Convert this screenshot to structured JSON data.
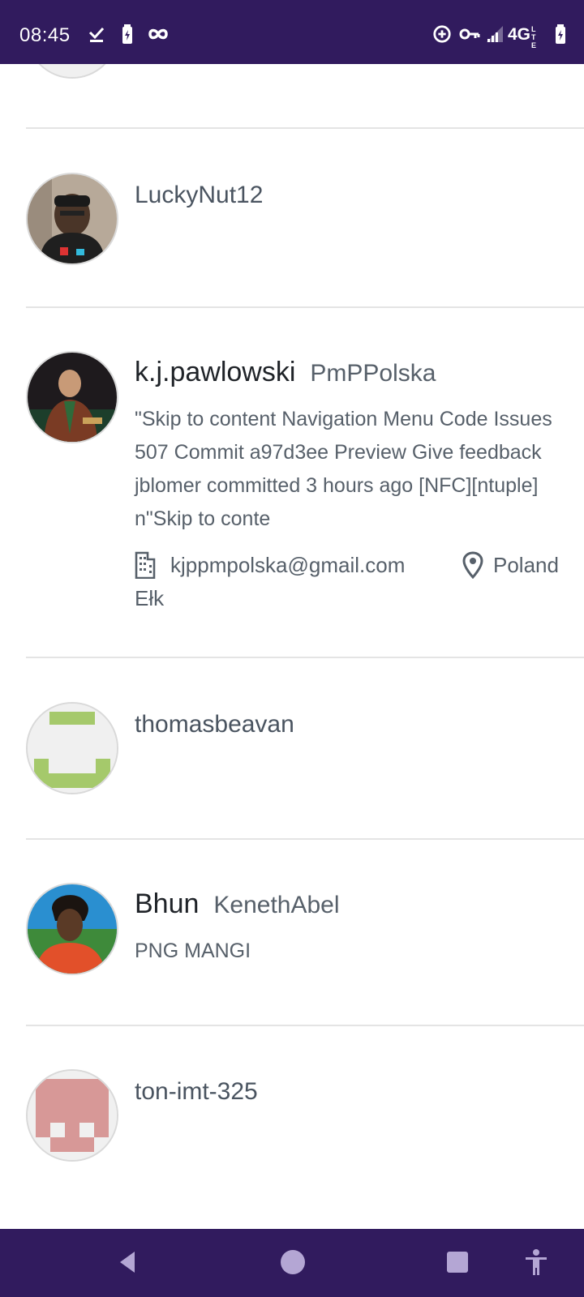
{
  "status_bar": {
    "time": "08:45",
    "icons_left": [
      "check-download-icon",
      "battery-saver-icon",
      "infinity-icon"
    ],
    "icons_right": [
      "data-saver-icon",
      "vpn-key-icon",
      "signal-icon",
      "network-label",
      "battery-icon"
    ],
    "network": "4G",
    "network_sub": "LTE"
  },
  "colors": {
    "system_bar": "#311b5e",
    "divider": "#e4e4e4",
    "text_primary": "#1f2328",
    "text_secondary": "#57606a",
    "identicon_green": "#a5c96b",
    "identicon_pink": "#d79897"
  },
  "users": [
    {
      "login": "LuckyNut12"
    },
    {
      "name": "k.j.pawlowski",
      "login": "PmPPolska",
      "bio": "\"Skip to content Navigation Menu Code Issues 507 Commit a97d3ee Preview Give feedback jblomer committed 3 hours ago [NFC][ntuple] n\"Skip to conte",
      "company_icon": "building-icon",
      "company": "kjppmpolska@gmail.com",
      "location_icon": "location-pin-icon",
      "location_line1": "Poland",
      "location_line2": "Ełk"
    },
    {
      "login": "thomasbeavan"
    },
    {
      "name": "Bhun",
      "login": "KenethAbel",
      "bio": "PNG MANGI"
    },
    {
      "login": "ton-imt-325"
    }
  ],
  "nav_bar": {
    "buttons": [
      "back-icon",
      "home-icon",
      "recents-icon",
      "accessibility-icon"
    ]
  }
}
